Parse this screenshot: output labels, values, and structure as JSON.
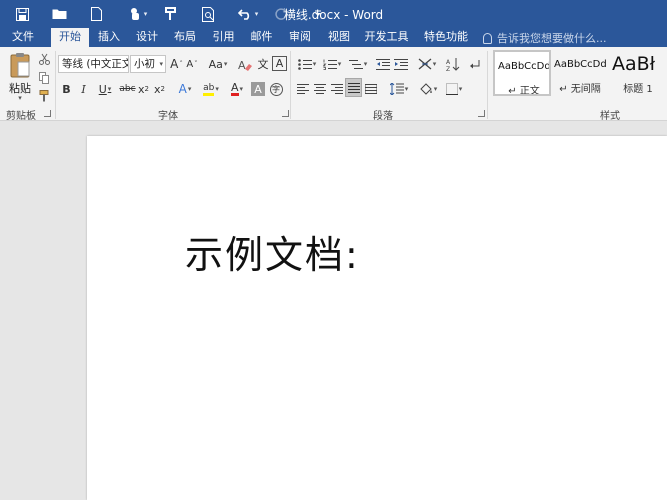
{
  "titlebar": {
    "title": "横线.docx - Word",
    "icons": [
      "save-icon",
      "open-folder-icon",
      "new-document-icon",
      "touch-mode-icon",
      "format-painter-icon",
      "print-preview-icon",
      "undo-icon",
      "redo-icon",
      "customize-quick-access-icon"
    ],
    "accent_color": "#2b579a"
  },
  "tabs": [
    "文件",
    "开始",
    "插入",
    "设计",
    "布局",
    "引用",
    "邮件",
    "审阅",
    "视图",
    "开发工具",
    "特色功能"
  ],
  "active_tab": "开始",
  "tell_me": {
    "placeholder": "告诉我您想要做什么..."
  },
  "ribbon": {
    "clipboard": {
      "paste_label": "粘贴",
      "group_label": "剪贴板"
    },
    "font": {
      "font_name": "等线 (中文正文",
      "font_size": "小初",
      "grow_label": "A",
      "shrink_label": "A",
      "case_label": "Aa",
      "pinyin_label": "文",
      "border_label": "A",
      "bold": "B",
      "italic": "I",
      "underline": "U",
      "strike": "abc",
      "subscript": "x",
      "superscript": "x",
      "sub_mark": "2",
      "sup_mark": "2",
      "effects": "A",
      "highlight": "ab",
      "font_color": "A",
      "shading": "A",
      "enclose": "字",
      "group_label": "字体"
    },
    "paragraph": {
      "group_label": "段落"
    },
    "styles": {
      "items": [
        {
          "sample": "AaBbCcDd",
          "name": "↵ 正文"
        },
        {
          "sample": "AaBbCcDd",
          "name": "↵ 无间隔"
        },
        {
          "sample": "AaBł",
          "name": "标题 1"
        }
      ],
      "group_label": "样式"
    }
  },
  "document": {
    "text": "示例文档:"
  }
}
